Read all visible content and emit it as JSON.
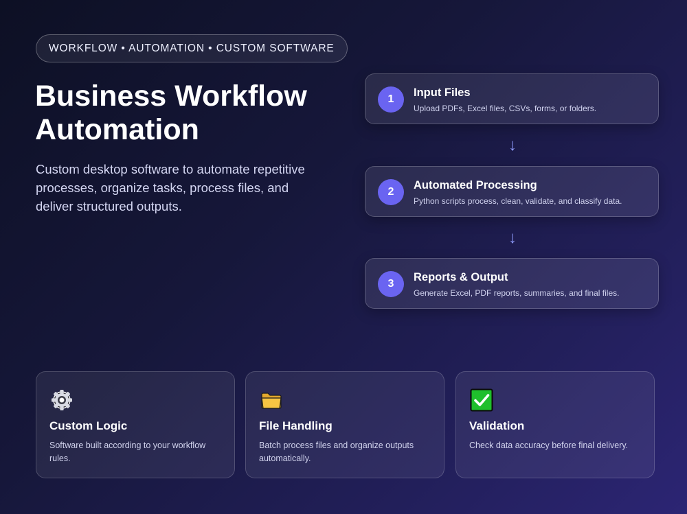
{
  "hero": {
    "tag": "WORKFLOW • AUTOMATION • CUSTOM SOFTWARE",
    "title_line1": "Business Workflow",
    "title_line2": "Automation",
    "description": "Custom desktop software to automate repetitive processes, organize tasks, process files, and deliver structured outputs."
  },
  "steps": [
    {
      "number": "1",
      "title": "Input Files",
      "description": "Upload PDFs, Excel files, CSVs, forms, or folders."
    },
    {
      "number": "2",
      "title": "Automated Processing",
      "description": "Python scripts process, clean, validate, and classify data."
    },
    {
      "number": "3",
      "title": "Reports & Output",
      "description": "Generate Excel, PDF reports, summaries, and final files."
    }
  ],
  "arrow_glyph": "↓",
  "features": [
    {
      "icon": "gear-icon",
      "title": "Custom Logic",
      "description": "Software built according to your workflow rules."
    },
    {
      "icon": "folder-icon",
      "title": "File Handling",
      "description": "Batch process files and organize outputs automatically."
    },
    {
      "icon": "checkmark-icon",
      "title": "Validation",
      "description": "Check data accuracy before final delivery."
    }
  ],
  "colors": {
    "accent": "#6a64f1",
    "arrow": "#8f9bff",
    "check_green": "#1fbf2c",
    "folder_yellow": "#f6c443"
  }
}
